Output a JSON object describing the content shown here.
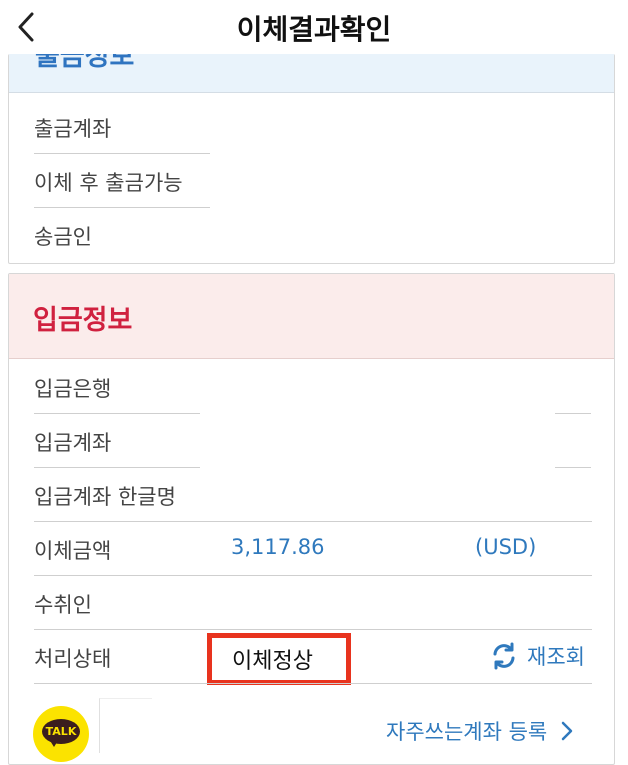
{
  "header": {
    "title": "이체결과확인",
    "back_icon": "chevron-left-icon"
  },
  "withdraw_section": {
    "title": "출금정보",
    "rows": [
      {
        "label": "출금계좌"
      },
      {
        "label": "이체 후 출금가능"
      },
      {
        "label": "송금인"
      }
    ]
  },
  "deposit_section": {
    "title": "입금정보",
    "rows": [
      {
        "label": "입금은행"
      },
      {
        "label": "입금계좌"
      },
      {
        "label": "입금계좌 한글명"
      },
      {
        "label": "이체금액",
        "amount": "3,117.86",
        "currency": "(USD)"
      },
      {
        "label": "수취인"
      },
      {
        "label": "처리상태",
        "status": "이체정상",
        "refresh_label": "재조회"
      }
    ]
  },
  "footer": {
    "kakao_label": "TALK",
    "favorite_link_label": "자주쓰는계좌 등록"
  },
  "colors": {
    "accent_blue": "#2f79bd",
    "accent_red": "#d0213f",
    "highlight_border": "#e8331e",
    "kakao_yellow": "#fbe300"
  }
}
